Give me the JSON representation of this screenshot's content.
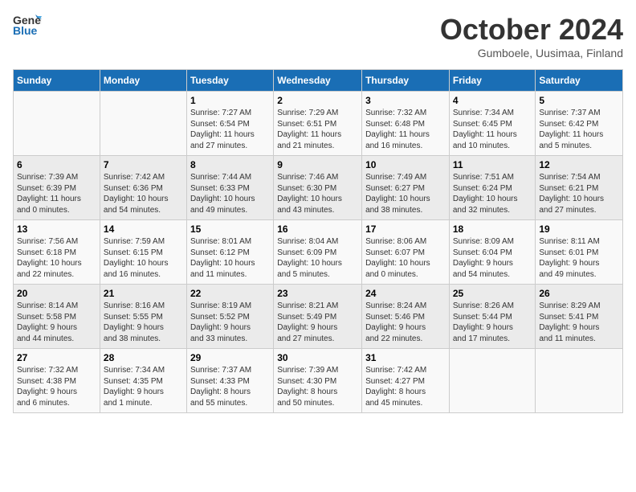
{
  "logo": {
    "line1": "General",
    "line2": "Blue"
  },
  "header": {
    "month": "October 2024",
    "location": "Gumboele, Uusimaa, Finland"
  },
  "weekdays": [
    "Sunday",
    "Monday",
    "Tuesday",
    "Wednesday",
    "Thursday",
    "Friday",
    "Saturday"
  ],
  "weeks": [
    [
      {
        "day": null,
        "text": null
      },
      {
        "day": null,
        "text": null
      },
      {
        "day": "1",
        "text": "Sunrise: 7:27 AM\nSunset: 6:54 PM\nDaylight: 11 hours\nand 27 minutes."
      },
      {
        "day": "2",
        "text": "Sunrise: 7:29 AM\nSunset: 6:51 PM\nDaylight: 11 hours\nand 21 minutes."
      },
      {
        "day": "3",
        "text": "Sunrise: 7:32 AM\nSunset: 6:48 PM\nDaylight: 11 hours\nand 16 minutes."
      },
      {
        "day": "4",
        "text": "Sunrise: 7:34 AM\nSunset: 6:45 PM\nDaylight: 11 hours\nand 10 minutes."
      },
      {
        "day": "5",
        "text": "Sunrise: 7:37 AM\nSunset: 6:42 PM\nDaylight: 11 hours\nand 5 minutes."
      }
    ],
    [
      {
        "day": "6",
        "text": "Sunrise: 7:39 AM\nSunset: 6:39 PM\nDaylight: 11 hours\nand 0 minutes."
      },
      {
        "day": "7",
        "text": "Sunrise: 7:42 AM\nSunset: 6:36 PM\nDaylight: 10 hours\nand 54 minutes."
      },
      {
        "day": "8",
        "text": "Sunrise: 7:44 AM\nSunset: 6:33 PM\nDaylight: 10 hours\nand 49 minutes."
      },
      {
        "day": "9",
        "text": "Sunrise: 7:46 AM\nSunset: 6:30 PM\nDaylight: 10 hours\nand 43 minutes."
      },
      {
        "day": "10",
        "text": "Sunrise: 7:49 AM\nSunset: 6:27 PM\nDaylight: 10 hours\nand 38 minutes."
      },
      {
        "day": "11",
        "text": "Sunrise: 7:51 AM\nSunset: 6:24 PM\nDaylight: 10 hours\nand 32 minutes."
      },
      {
        "day": "12",
        "text": "Sunrise: 7:54 AM\nSunset: 6:21 PM\nDaylight: 10 hours\nand 27 minutes."
      }
    ],
    [
      {
        "day": "13",
        "text": "Sunrise: 7:56 AM\nSunset: 6:18 PM\nDaylight: 10 hours\nand 22 minutes."
      },
      {
        "day": "14",
        "text": "Sunrise: 7:59 AM\nSunset: 6:15 PM\nDaylight: 10 hours\nand 16 minutes."
      },
      {
        "day": "15",
        "text": "Sunrise: 8:01 AM\nSunset: 6:12 PM\nDaylight: 10 hours\nand 11 minutes."
      },
      {
        "day": "16",
        "text": "Sunrise: 8:04 AM\nSunset: 6:09 PM\nDaylight: 10 hours\nand 5 minutes."
      },
      {
        "day": "17",
        "text": "Sunrise: 8:06 AM\nSunset: 6:07 PM\nDaylight: 10 hours\nand 0 minutes."
      },
      {
        "day": "18",
        "text": "Sunrise: 8:09 AM\nSunset: 6:04 PM\nDaylight: 9 hours\nand 54 minutes."
      },
      {
        "day": "19",
        "text": "Sunrise: 8:11 AM\nSunset: 6:01 PM\nDaylight: 9 hours\nand 49 minutes."
      }
    ],
    [
      {
        "day": "20",
        "text": "Sunrise: 8:14 AM\nSunset: 5:58 PM\nDaylight: 9 hours\nand 44 minutes."
      },
      {
        "day": "21",
        "text": "Sunrise: 8:16 AM\nSunset: 5:55 PM\nDaylight: 9 hours\nand 38 minutes."
      },
      {
        "day": "22",
        "text": "Sunrise: 8:19 AM\nSunset: 5:52 PM\nDaylight: 9 hours\nand 33 minutes."
      },
      {
        "day": "23",
        "text": "Sunrise: 8:21 AM\nSunset: 5:49 PM\nDaylight: 9 hours\nand 27 minutes."
      },
      {
        "day": "24",
        "text": "Sunrise: 8:24 AM\nSunset: 5:46 PM\nDaylight: 9 hours\nand 22 minutes."
      },
      {
        "day": "25",
        "text": "Sunrise: 8:26 AM\nSunset: 5:44 PM\nDaylight: 9 hours\nand 17 minutes."
      },
      {
        "day": "26",
        "text": "Sunrise: 8:29 AM\nSunset: 5:41 PM\nDaylight: 9 hours\nand 11 minutes."
      }
    ],
    [
      {
        "day": "27",
        "text": "Sunrise: 7:32 AM\nSunset: 4:38 PM\nDaylight: 9 hours\nand 6 minutes."
      },
      {
        "day": "28",
        "text": "Sunrise: 7:34 AM\nSunset: 4:35 PM\nDaylight: 9 hours\nand 1 minute."
      },
      {
        "day": "29",
        "text": "Sunrise: 7:37 AM\nSunset: 4:33 PM\nDaylight: 8 hours\nand 55 minutes."
      },
      {
        "day": "30",
        "text": "Sunrise: 7:39 AM\nSunset: 4:30 PM\nDaylight: 8 hours\nand 50 minutes."
      },
      {
        "day": "31",
        "text": "Sunrise: 7:42 AM\nSunset: 4:27 PM\nDaylight: 8 hours\nand 45 minutes."
      },
      {
        "day": null,
        "text": null
      },
      {
        "day": null,
        "text": null
      }
    ]
  ]
}
